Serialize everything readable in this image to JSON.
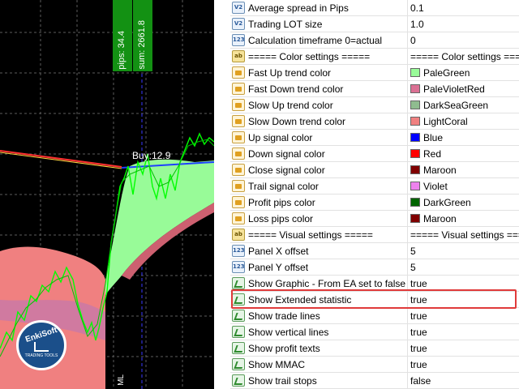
{
  "chart": {
    "pips_label": "pips: 34.4",
    "sum_label": "sum: 2661.8",
    "trade_label": "Buy:12.9",
    "symbol_fragment": "ML",
    "logo_brand": "EnkiSoft",
    "logo_tagline": "TRADING TOOLS"
  },
  "properties": [
    {
      "icon": "v2",
      "name": "Average spread in Pips",
      "value": "0.1"
    },
    {
      "icon": "v2",
      "name": "Trading LOT size",
      "value": "1.0"
    },
    {
      "icon": "123",
      "name": "Calculation timeframe 0=actual",
      "value": "0"
    },
    {
      "icon": "ab",
      "name": "===== Color settings =====",
      "value": "===== Color settings ====="
    },
    {
      "icon": "color",
      "name": "Fast Up trend color",
      "value": "PaleGreen",
      "swatch": "#98fb98"
    },
    {
      "icon": "color",
      "name": "Fast Down trend color",
      "value": "PaleVioletRed",
      "swatch": "#db7093"
    },
    {
      "icon": "color",
      "name": "Slow Up trend color",
      "value": "DarkSeaGreen",
      "swatch": "#8fbc8f"
    },
    {
      "icon": "color",
      "name": "Slow Down trend color",
      "value": "LightCoral",
      "swatch": "#f08080"
    },
    {
      "icon": "color",
      "name": "Up signal color",
      "value": "Blue",
      "swatch": "#0000ff"
    },
    {
      "icon": "color",
      "name": "Down signal color",
      "value": "Red",
      "swatch": "#ff0000"
    },
    {
      "icon": "color",
      "name": "Close signal color",
      "value": "Maroon",
      "swatch": "#800000"
    },
    {
      "icon": "color",
      "name": "Trail signal color",
      "value": "Violet",
      "swatch": "#ee82ee"
    },
    {
      "icon": "color",
      "name": "Profit pips color",
      "value": "DarkGreen",
      "swatch": "#006400"
    },
    {
      "icon": "color",
      "name": "Loss pips color",
      "value": "Maroon",
      "swatch": "#800000"
    },
    {
      "icon": "ab",
      "name": "===== Visual settings =====",
      "value": "===== Visual settings ====="
    },
    {
      "icon": "123",
      "name": "Panel X offset",
      "value": "5"
    },
    {
      "icon": "123",
      "name": "Panel Y offset",
      "value": "5"
    },
    {
      "icon": "bool",
      "name": "Show Graphic - From EA set to false",
      "value": "true"
    },
    {
      "icon": "bool",
      "name": "Show Extended statistic",
      "value": "true",
      "highlighted": true
    },
    {
      "icon": "bool",
      "name": "Show trade lines",
      "value": "true"
    },
    {
      "icon": "bool",
      "name": "Show vertical lines",
      "value": "true"
    },
    {
      "icon": "bool",
      "name": "Show profit texts",
      "value": "true"
    },
    {
      "icon": "bool",
      "name": "Show MMAC",
      "value": "true"
    },
    {
      "icon": "bool",
      "name": "Show trail stops",
      "value": "false"
    }
  ],
  "colors": {
    "chart_background": "#000000",
    "price_line": "#00ff00",
    "up_cloud": "#98fb98",
    "down_cloud": "#f08080",
    "highlight_box": "#e03a3a",
    "badge": "#139113"
  }
}
